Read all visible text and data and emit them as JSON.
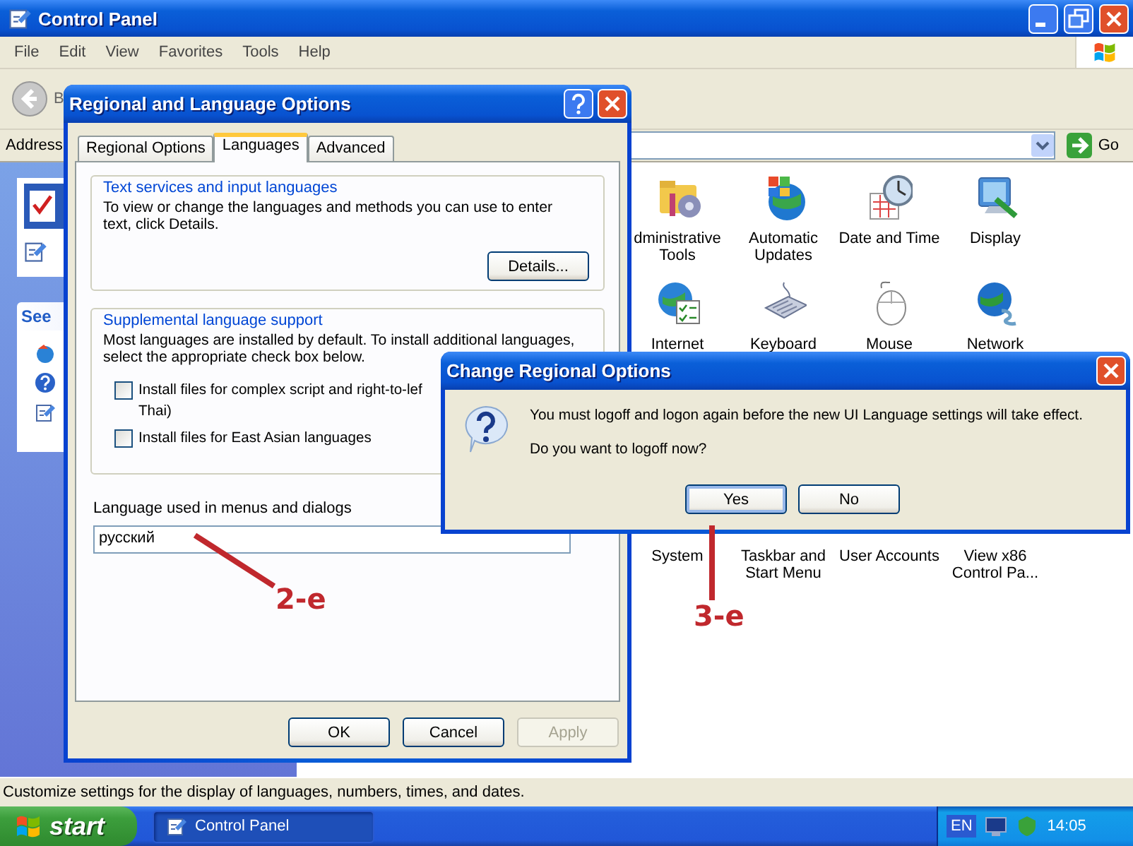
{
  "window": {
    "title": "Control Panel"
  },
  "menu": [
    "File",
    "Edit",
    "View",
    "Favorites",
    "Tools",
    "Help"
  ],
  "toolbar": {
    "back_label": "B"
  },
  "address_bar": {
    "label": "Address",
    "go": "Go"
  },
  "sidebar": {
    "header": "See"
  },
  "icon_rows": [
    [
      {
        "kind": "admin",
        "lines": [
          "dministrative",
          "Tools"
        ]
      },
      {
        "kind": "updates",
        "lines": [
          "Automatic",
          "Updates"
        ]
      },
      {
        "kind": "datetime",
        "lines": [
          "Date and Time"
        ]
      },
      {
        "kind": "display",
        "lines": [
          "Display"
        ]
      }
    ],
    [
      {
        "kind": "internet",
        "lines": [
          "Internet"
        ]
      },
      {
        "kind": "keyboard",
        "lines": [
          "Keyboard"
        ]
      },
      {
        "kind": "mouse",
        "lines": [
          "Mouse"
        ]
      },
      {
        "kind": "network",
        "lines": [
          "Network"
        ]
      }
    ],
    [
      {
        "lines": [
          "System"
        ]
      },
      {
        "lines": [
          "Taskbar and",
          "Start Menu"
        ]
      },
      {
        "lines": [
          "User Accounts"
        ]
      },
      {
        "lines": [
          "View x86",
          "Control Pa..."
        ]
      }
    ]
  ],
  "status_bar": "Customize settings for the display of languages, numbers, times, and dates.",
  "regional_dialog": {
    "title": "Regional and Language Options",
    "tabs": [
      {
        "label": "Regional Options",
        "selected": false
      },
      {
        "label": "Languages",
        "selected": true
      },
      {
        "label": "Advanced",
        "selected": false
      }
    ],
    "text_services": {
      "legend": "Text services and input languages",
      "lines": [
        "To view or change the languages and methods you can use to enter",
        "text, click Details."
      ],
      "button": "Details..."
    },
    "supplemental": {
      "legend": "Supplemental language support",
      "lines": [
        "Most languages are installed by default. To install additional languages,",
        "select the appropriate check box below."
      ],
      "checkboxes": [
        {
          "lines": [
            "Install files for complex script and right-to-lef",
            "Thai)"
          ],
          "checked": false
        },
        {
          "lines": [
            "Install files for East Asian languages"
          ],
          "checked": false
        }
      ]
    },
    "menu_language": {
      "label": "Language used in menus and dialogs",
      "value": "русский"
    },
    "buttons": [
      {
        "label": "OK",
        "disabled": false
      },
      {
        "label": "Cancel",
        "disabled": false
      },
      {
        "label": "Apply",
        "disabled": true
      }
    ]
  },
  "confirm_dialog": {
    "title": "Change Regional Options",
    "message": "You must logoff and logon again before the new UI Language settings will take effect.",
    "question": "Do you want to logoff now?",
    "buttons": [
      {
        "label": "Yes",
        "selected": true
      },
      {
        "label": "No",
        "selected": false
      }
    ]
  },
  "annotations": [
    {
      "label": "2-e"
    },
    {
      "label": "3-e"
    }
  ],
  "taskbar": {
    "start": "start",
    "tasks": [
      {
        "label": "Control Panel",
        "selected": true
      }
    ],
    "language": "EN",
    "clock": "14:05"
  }
}
